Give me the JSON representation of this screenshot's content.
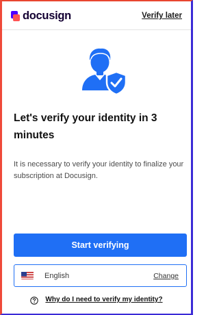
{
  "header": {
    "brand": "docusign",
    "verify_later": "Verify later"
  },
  "hero": {
    "icon": "user-verified-shield-icon"
  },
  "main": {
    "title": "Let's verify your identity in 3 minutes",
    "description": "It is necessary to verify your identity to finalize your subscription at Docusign."
  },
  "actions": {
    "start_verifying": "Start verifying"
  },
  "language": {
    "flag": "us-flag-icon",
    "selected": "English",
    "change": "Change"
  },
  "help": {
    "icon": "question-circle-icon",
    "link": "Why do I need to verify my identity?"
  },
  "colors": {
    "accent": "#1f6ff5",
    "brand_purple": "#4c00ff",
    "brand_red": "#ff5252",
    "title": "#111111"
  }
}
